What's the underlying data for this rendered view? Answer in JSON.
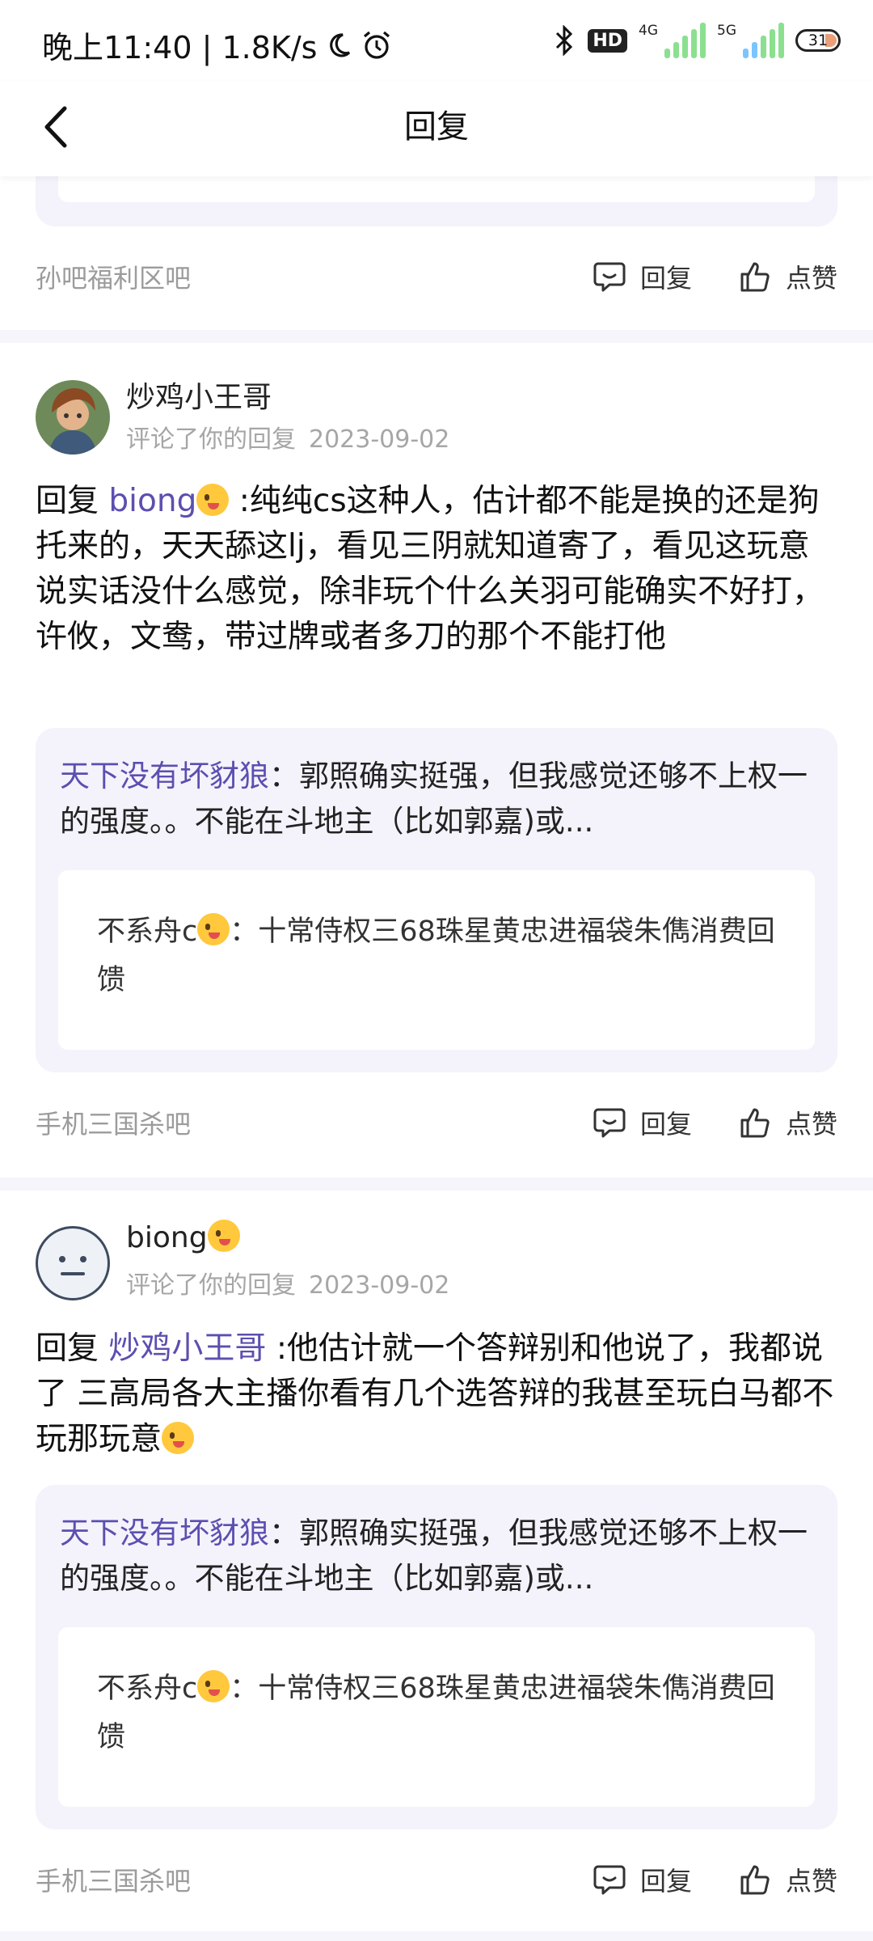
{
  "status_bar": {
    "time_speed": "晚上11:40 | 1.8K/s",
    "hd_label": "HD",
    "net_4g": "4G",
    "net_5g": "5G",
    "battery": "31"
  },
  "header": {
    "title": "回复"
  },
  "actions": {
    "reply": "回复",
    "like": "点赞"
  },
  "partial_card": {
    "forum": "孙吧福利区吧"
  },
  "posts": [
    {
      "username": "炒鸡小王哥",
      "meta": "评论了你的回复",
      "date": "2023-09-02",
      "reply_prefix": "回复",
      "mention": "biong",
      "body": ":纯纯cs这种人，估计都不能是换的还是狗托来的，天天舔这lj，看见三阴就知道寄了，看见这玩意说实话没什么感觉，除非玩个什么关羽可能确实不好打，许攸，文鸯，带过牌或者多刀的那个不能打他",
      "quote_name": "天下没有坏豺狼",
      "quote_text": "：郭照确实挺强，但我感觉还够不上权一的强度。。不能在斗地主（比如郭嘉)或...",
      "inner_name": "不系舟c",
      "inner_text": "：十常侍权三68珠星黄忠进福袋朱儁消费回馈",
      "forum": "手机三国杀吧"
    },
    {
      "username": "biong",
      "meta": "评论了你的回复",
      "date": "2023-09-02",
      "reply_prefix": "回复",
      "mention": "炒鸡小王哥",
      "body": ":他估计就一个答辩别和他说了，我都说了 三高局各大主播你看有几个选答辩的我甚至玩白马都不玩那玩意",
      "quote_name": "天下没有坏豺狼",
      "quote_text": "：郭照确实挺强，但我感觉还够不上权一的强度。。不能在斗地主（比如郭嘉)或...",
      "inner_name": "不系舟c",
      "inner_text": "：十常侍权三68珠星黄忠进福袋朱儁消费回馈",
      "forum": "手机三国杀吧"
    }
  ]
}
